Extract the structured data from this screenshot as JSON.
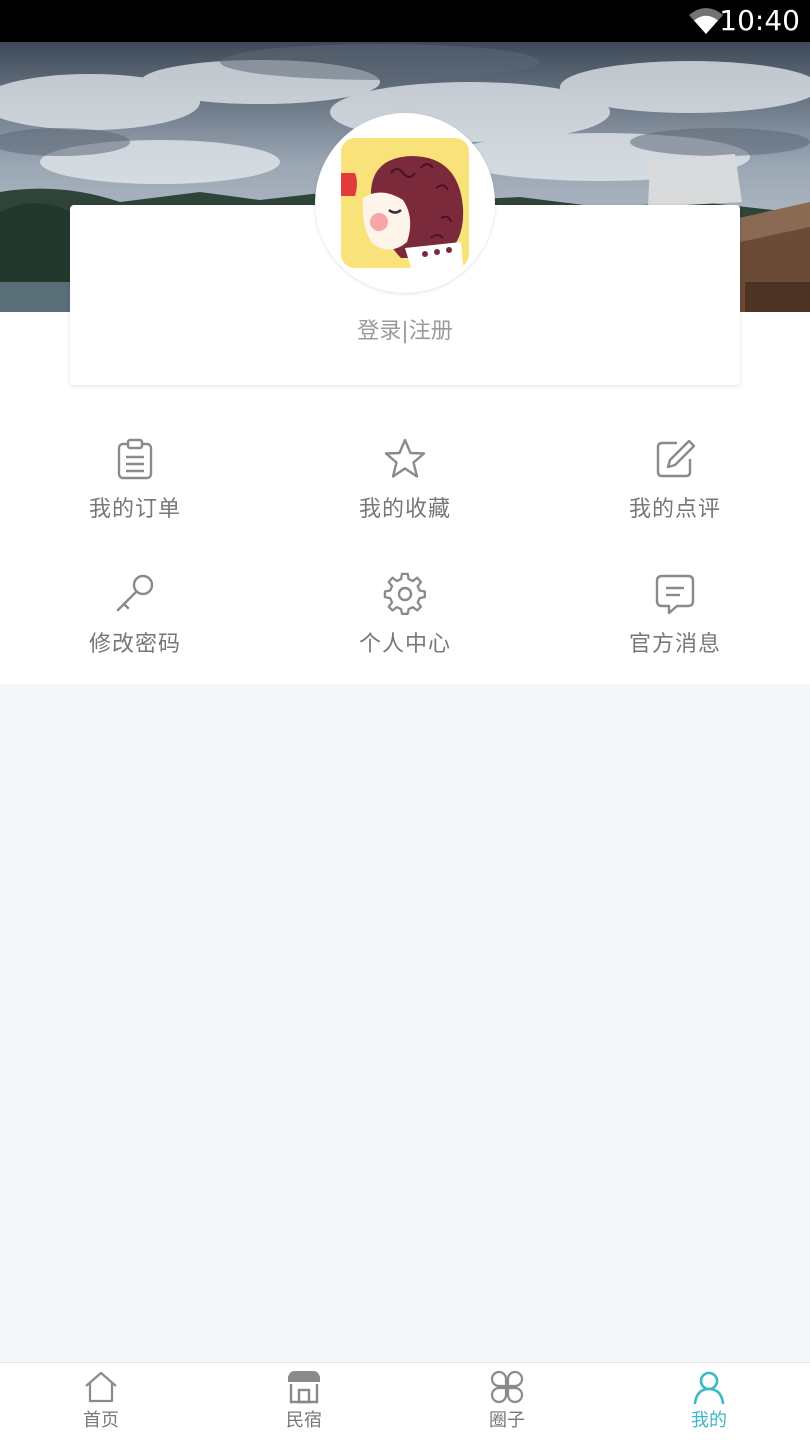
{
  "status_bar": {
    "time": "10:40"
  },
  "profile": {
    "login_text": "登录|注册"
  },
  "menu": [
    {
      "label": "我的订单",
      "icon": "clipboard-icon"
    },
    {
      "label": "我的收藏",
      "icon": "star-icon"
    },
    {
      "label": "我的点评",
      "icon": "edit-icon"
    },
    {
      "label": "修改密码",
      "icon": "key-icon"
    },
    {
      "label": "个人中心",
      "icon": "gear-icon"
    },
    {
      "label": "官方消息",
      "icon": "message-icon"
    }
  ],
  "tabs": [
    {
      "label": "首页",
      "icon": "home-icon",
      "active": false
    },
    {
      "label": "民宿",
      "icon": "shop-icon",
      "active": false
    },
    {
      "label": "圈子",
      "icon": "circle-grid-icon",
      "active": false
    },
    {
      "label": "我的",
      "icon": "user-icon",
      "active": true
    }
  ],
  "colors": {
    "accent": "#3bb9c4",
    "icon_gray": "#8a8a8a",
    "page_bg": "#f6f7f9"
  }
}
